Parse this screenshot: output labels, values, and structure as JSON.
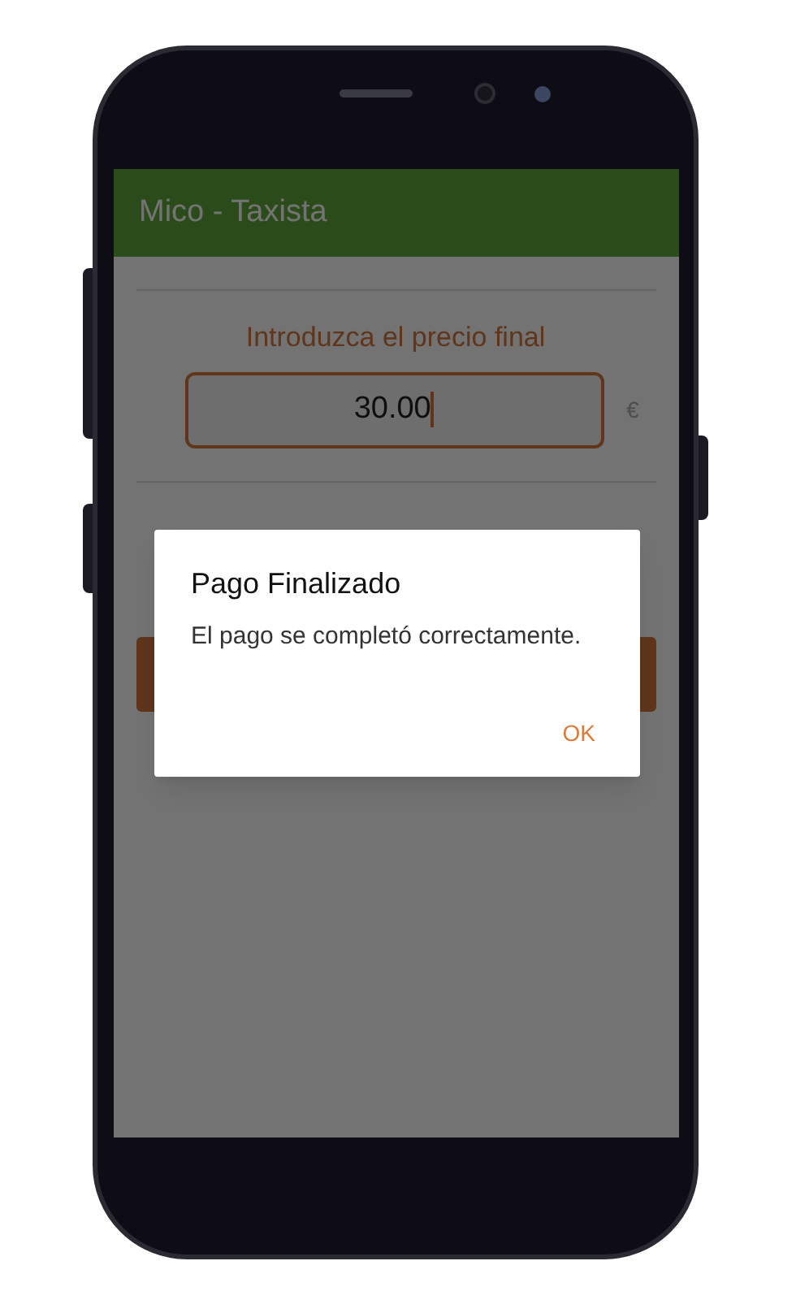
{
  "app_bar": {
    "title": "Mico - Taxista"
  },
  "form": {
    "label": "Introduzca el precio final",
    "price_field": {
      "value": "30.00"
    },
    "currency": "€"
  },
  "dialog": {
    "title": "Pago Finalizado",
    "message": "El pago se completó correctamente.",
    "buttons": [
      "OK"
    ]
  }
}
